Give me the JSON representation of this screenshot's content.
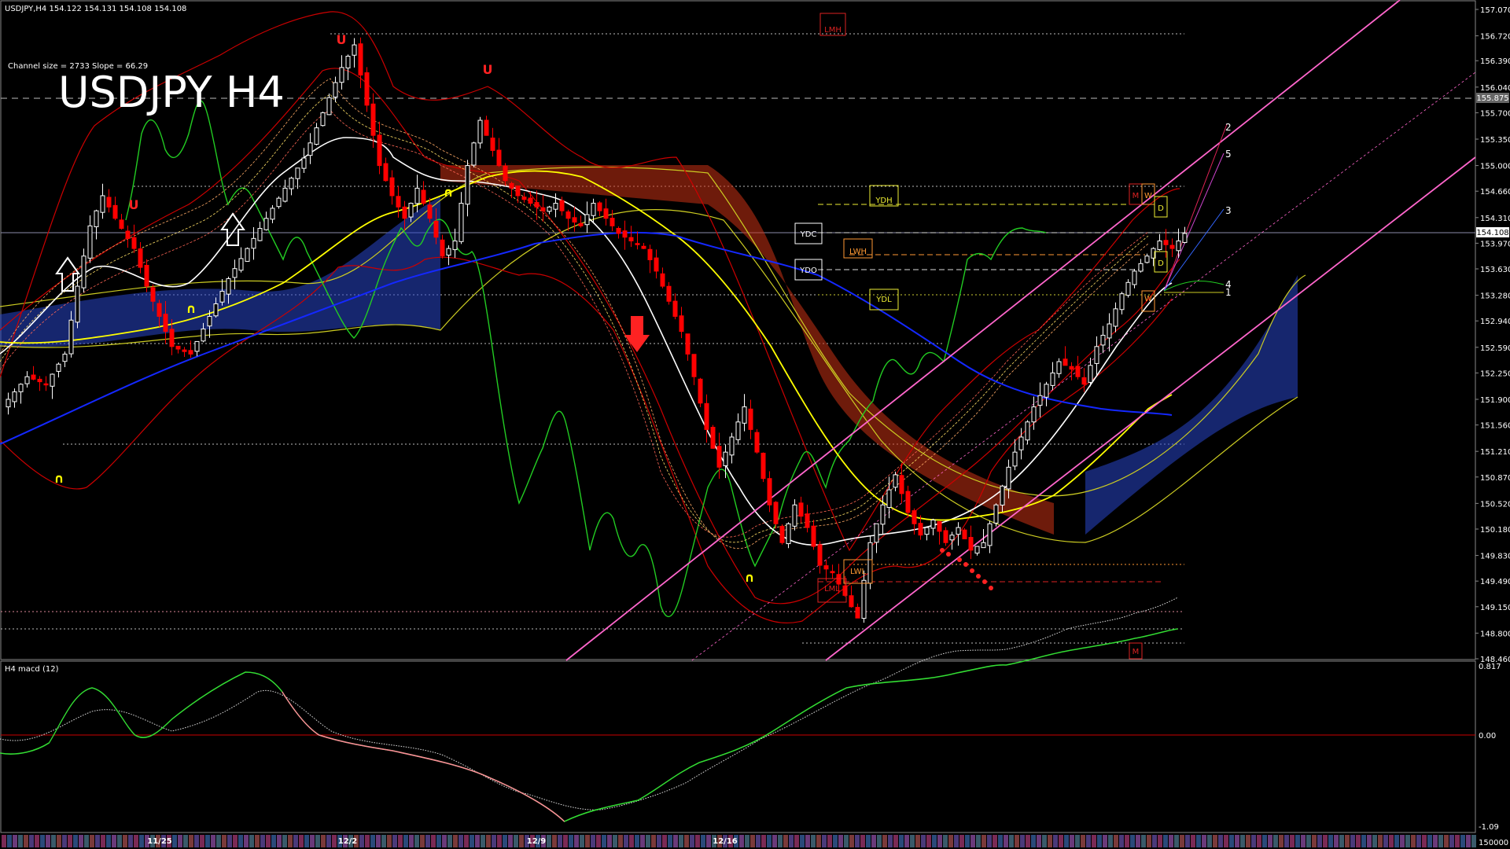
{
  "header": {
    "symbol_info": "USDJPY,H4  154.122 154.131 154.108 154.108",
    "channel_info": "Channel size = 2733 Slope = 66.29",
    "big_title": "USDJPY H4"
  },
  "price_axis": {
    "ticks": [
      "157.070",
      "156.720",
      "156.390",
      "156.040",
      "155.700",
      "155.350",
      "155.000",
      "154.660",
      "154.310",
      "153.970",
      "153.630",
      "153.280",
      "152.940",
      "152.590",
      "152.250",
      "151.900",
      "151.560",
      "151.210",
      "150.870",
      "150.520",
      "150.180",
      "149.830",
      "149.490",
      "149.150",
      "148.800",
      "148.460"
    ],
    "current_price": "154.108",
    "ref_price": "155.875"
  },
  "level_labels": {
    "lmh": "LMH",
    "ydh": "YDH",
    "ydc": "YDC",
    "lwh": "LWH",
    "ydo": "YDO",
    "ydl": "YDL",
    "lwl": "LWL",
    "lml": "LML",
    "m_top": "M",
    "w_top": "W",
    "d_top": "D",
    "d_mid": "D",
    "w_mid": "W",
    "m_bottom": "M"
  },
  "fan_labels": [
    "2",
    "5",
    "3",
    "4",
    "1"
  ],
  "macd": {
    "label": "H4  macd (12)",
    "ticks": [
      "0.817",
      "0.00",
      "-1.09"
    ],
    "corner": "150000"
  },
  "time_axis": [
    "11/25",
    "12/2",
    "12/9",
    "12/16"
  ],
  "colors": {
    "bull": "#ffffff",
    "bear": "#ff0000",
    "ema_white": "#ffffff",
    "ema_yellow": "#ffff00",
    "ema_blue": "#1428ff",
    "boll": "#cc0000",
    "chikou": "#22cc22",
    "channel": "#ff66cc",
    "macd_up": "#33dd33",
    "macd_down": "#ff8899"
  },
  "chart_data": {
    "type": "candlestick",
    "title": "USDJPY H4",
    "instrument": "USDJPY",
    "timeframe": "H4",
    "ohlc": [
      154.122,
      154.131,
      154.108,
      154.108
    ],
    "ylim": [
      148.46,
      157.07
    ],
    "x_ticks": [
      "11/25",
      "12/2",
      "12/9",
      "12/16"
    ],
    "close_path": [
      [
        0,
        151.9
      ],
      [
        3,
        152.2
      ],
      [
        6,
        152.1
      ],
      [
        9,
        152.5
      ],
      [
        11,
        153.4
      ],
      [
        13,
        154.2
      ],
      [
        15,
        154.6
      ],
      [
        17,
        154.3
      ],
      [
        20,
        153.9
      ],
      [
        22,
        153.4
      ],
      [
        24,
        153.0
      ],
      [
        26,
        152.6
      ],
      [
        29,
        152.5
      ],
      [
        32,
        153.0
      ],
      [
        35,
        153.5
      ],
      [
        38,
        153.9
      ],
      [
        41,
        154.3
      ],
      [
        44,
        154.7
      ],
      [
        47,
        155.1
      ],
      [
        50,
        155.7
      ],
      [
        53,
        156.3
      ],
      [
        55,
        156.6
      ],
      [
        57,
        155.8
      ],
      [
        59,
        155.0
      ],
      [
        61,
        154.6
      ],
      [
        63,
        154.3
      ],
      [
        65,
        154.7
      ],
      [
        67,
        154.3
      ],
      [
        69,
        153.8
      ],
      [
        71,
        154.0
      ],
      [
        73,
        155.0
      ],
      [
        75,
        155.6
      ],
      [
        77,
        155.2
      ],
      [
        79,
        154.8
      ],
      [
        81,
        154.6
      ],
      [
        83,
        154.5
      ],
      [
        85,
        154.4
      ],
      [
        87,
        154.5
      ],
      [
        89,
        154.3
      ],
      [
        91,
        154.2
      ],
      [
        93,
        154.5
      ],
      [
        95,
        154.3
      ],
      [
        97,
        154.1
      ],
      [
        99,
        154.0
      ],
      [
        101,
        153.9
      ],
      [
        103,
        153.6
      ],
      [
        105,
        153.2
      ],
      [
        107,
        152.8
      ],
      [
        109,
        152.2
      ],
      [
        111,
        151.5
      ],
      [
        113,
        151.0
      ],
      [
        115,
        151.4
      ],
      [
        117,
        151.8
      ],
      [
        119,
        151.2
      ],
      [
        121,
        150.5
      ],
      [
        123,
        150.0
      ],
      [
        125,
        150.5
      ],
      [
        127,
        150.2
      ],
      [
        129,
        149.7
      ],
      [
        131,
        149.6
      ],
      [
        133,
        149.3
      ],
      [
        135,
        149.0
      ],
      [
        137,
        150.0
      ],
      [
        139,
        150.5
      ],
      [
        141,
        150.9
      ],
      [
        143,
        150.4
      ],
      [
        145,
        150.1
      ],
      [
        147,
        150.3
      ],
      [
        149,
        150.0
      ],
      [
        151,
        150.2
      ],
      [
        153,
        149.9
      ],
      [
        155,
        150.0
      ],
      [
        157,
        150.5
      ],
      [
        159,
        151.0
      ],
      [
        161,
        151.4
      ],
      [
        163,
        151.8
      ],
      [
        165,
        152.1
      ],
      [
        167,
        152.4
      ],
      [
        169,
        152.3
      ],
      [
        171,
        152.1
      ],
      [
        173,
        152.6
      ],
      [
        175,
        152.9
      ],
      [
        177,
        153.3
      ],
      [
        179,
        153.6
      ],
      [
        181,
        153.8
      ],
      [
        183,
        154.0
      ],
      [
        185,
        153.9
      ],
      [
        187,
        154.1
      ]
    ],
    "series": [
      {
        "name": "macd (12)",
        "ylim": [
          -1.09,
          0.817
        ]
      }
    ]
  }
}
